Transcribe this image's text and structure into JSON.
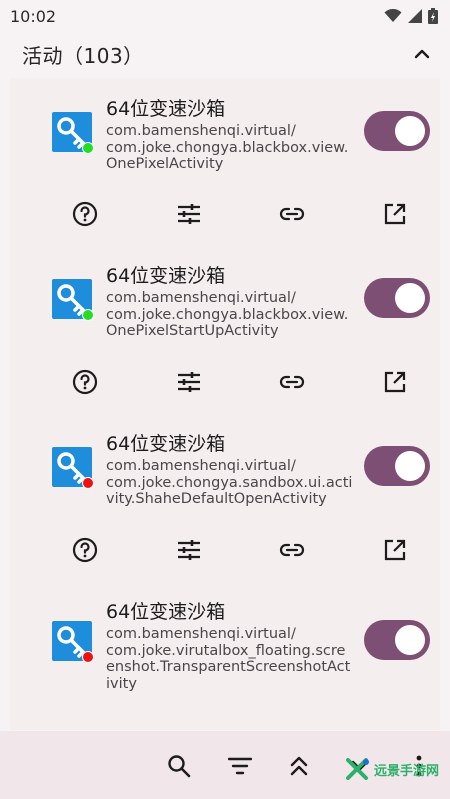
{
  "status_bar": {
    "time": "10:02"
  },
  "section": {
    "title": "活动（103）"
  },
  "entries": [
    {
      "app_name": "64位变速沙箱",
      "component": "com.bamenshenqi.virtual/\ncom.joke.chongya.blackbox.view.\nOnePixelActivity",
      "status_color": "#22dd22",
      "enabled": true
    },
    {
      "app_name": "64位变速沙箱",
      "component": "com.bamenshenqi.virtual/\ncom.joke.chongya.blackbox.view.\nOnePixelStartUpActivity",
      "status_color": "#22dd22",
      "enabled": true
    },
    {
      "app_name": "64位变速沙箱",
      "component": "com.bamenshenqi.virtual/\ncom.joke.chongya.sandbox.ui.acti\nvity.ShaheDefaultOpenActivity",
      "status_color": "#ee1111",
      "enabled": true
    },
    {
      "app_name": "64位变速沙箱",
      "component": "com.bamenshenqi.virtual/\ncom.joke.virutalbox_floating.scre\nenshot.TransparentScreenshotAct\nivity",
      "status_color": "#ee1111",
      "enabled": true
    }
  ],
  "actions": [
    "help-icon",
    "tune-icon",
    "link-icon",
    "open-in-new-icon"
  ],
  "bottom_bar": [
    "search-icon",
    "filter-icon",
    "collapse-all-icon",
    "expand-icon",
    "more-vert-icon"
  ],
  "watermark": {
    "text": "远景手游网"
  },
  "colors": {
    "accent": "#7d4f74",
    "icon_bg": "#1e8ddb"
  }
}
